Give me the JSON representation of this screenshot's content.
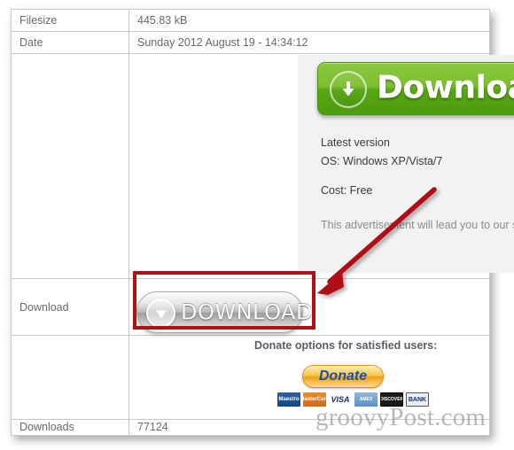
{
  "table": {
    "rows": [
      {
        "label": "Filesize",
        "value": "445.83 kB"
      },
      {
        "label": "Date",
        "value": "Sunday 2012 August 19 - 14:34:12"
      },
      {
        "label": "Download",
        "value": ""
      },
      {
        "label": "Downloads",
        "value": "77124"
      }
    ],
    "filesize_label": "Filesize",
    "filesize_value": "445.83 kB",
    "date_label": "Date",
    "date_value": "Sunday 2012 August 19 - 14:34:12",
    "download_label": "Download",
    "downloads_label": "Downloads",
    "downloads_value": "77124"
  },
  "advertisement": {
    "adchoices_icon": "adchoices-triangle-icon",
    "banner_label": "Download",
    "banner_icon": "download-arrow-circle-icon",
    "line_1": "Latest version",
    "line_2": "OS: Windows XP/Vista/7",
    "line_3": "Cost: Free",
    "disclaimer": "This advertisement will lead you to our site where you can download free Codecs"
  },
  "download_button": {
    "label": "DOWNLOAD",
    "icon": "download-arrow-circle-icon"
  },
  "donate": {
    "heading": "Donate options for satisfied users:",
    "button_label": "Donate",
    "cards": [
      {
        "name": "maestro-card-icon",
        "text": "Maestro"
      },
      {
        "name": "mastercard-card-icon",
        "text": "MasterCard"
      },
      {
        "name": "visa-card-icon",
        "text": "VISA"
      },
      {
        "name": "amex-card-icon",
        "text": "AMEX"
      },
      {
        "name": "discover-card-icon",
        "text": "DISCOVER"
      },
      {
        "name": "bank-transfer-icon",
        "text": "BANK"
      }
    ]
  },
  "annotations": {
    "highlight_box": "red-highlight-rectangle",
    "arrow": "red-pointer-arrow"
  },
  "watermark": {
    "text": "groovyPost.com"
  },
  "colors": {
    "accent_red": "#b01116",
    "green_button": "#6fba28",
    "orange_button": "#f3ab25",
    "text_gray": "#666a6e"
  }
}
